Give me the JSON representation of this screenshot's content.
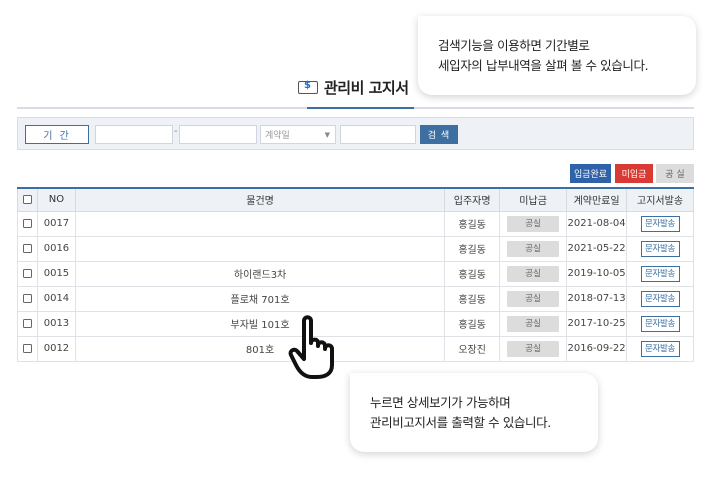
{
  "page": {
    "title": "관리비 고지서"
  },
  "bubbles": {
    "top": {
      "line1": "검색기능을 이용하면 기간별로",
      "line2": "세입자의 납부내역을 살펴 볼 수 있습니다."
    },
    "bottom": {
      "line1": "누르면 상세보기가 가능하며",
      "line2": "관리비고지서를 출력할 수 있습니다."
    }
  },
  "filter": {
    "period_label": "기 간",
    "dash": "-",
    "contract_placeholder": "계약일",
    "search_label": "검 색"
  },
  "legend": {
    "paid": "입금완료",
    "unpaid": "미입금",
    "vacant": "공 실"
  },
  "table": {
    "headers": [
      "",
      "NO",
      "물건명",
      "입주자명",
      "미납금",
      "계약만료일",
      "고지서발송"
    ],
    "rows": [
      {
        "no": "0017",
        "property": "",
        "tenant": "홍길동",
        "status": "공실",
        "expiry": "2021-08-04",
        "action": "문자발송"
      },
      {
        "no": "0016",
        "property": "",
        "tenant": "홍길동",
        "status": "공실",
        "expiry": "2021-05-22",
        "action": "문자발송"
      },
      {
        "no": "0015",
        "property": "하이랜드3차",
        "tenant": "홍길동",
        "status": "공실",
        "expiry": "2019-10-05",
        "action": "문자발송"
      },
      {
        "no": "0014",
        "property": "플로채 701호",
        "tenant": "홍길동",
        "status": "공실",
        "expiry": "2018-07-13",
        "action": "문자발송"
      },
      {
        "no": "0013",
        "property": "부자빌 101호",
        "tenant": "홍길동",
        "status": "공실",
        "expiry": "2017-10-25",
        "action": "문자발송"
      },
      {
        "no": "0012",
        "property": "801호",
        "tenant": "오장진",
        "status": "공실",
        "expiry": "2016-09-22",
        "action": "문자발송"
      }
    ]
  },
  "icons": {
    "title": "bill-icon",
    "pointer": "hand-pointer-icon"
  }
}
